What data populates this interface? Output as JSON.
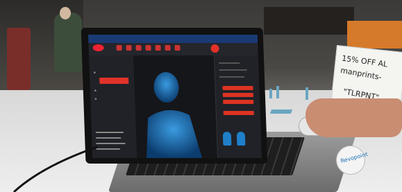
{
  "sign": {
    "line1": "15% OFF AL",
    "line2": "manprints-",
    "line3": "\"TLRPNT\""
  },
  "sticker_text": "Revopoint",
  "app": {
    "left_panel": {
      "label1": "a",
      "label2": "a",
      "label3": "a"
    }
  },
  "colors": {
    "accent": "#e0322a",
    "scan_blue": "#1f7fc8",
    "topbar": "#1a3a74"
  }
}
